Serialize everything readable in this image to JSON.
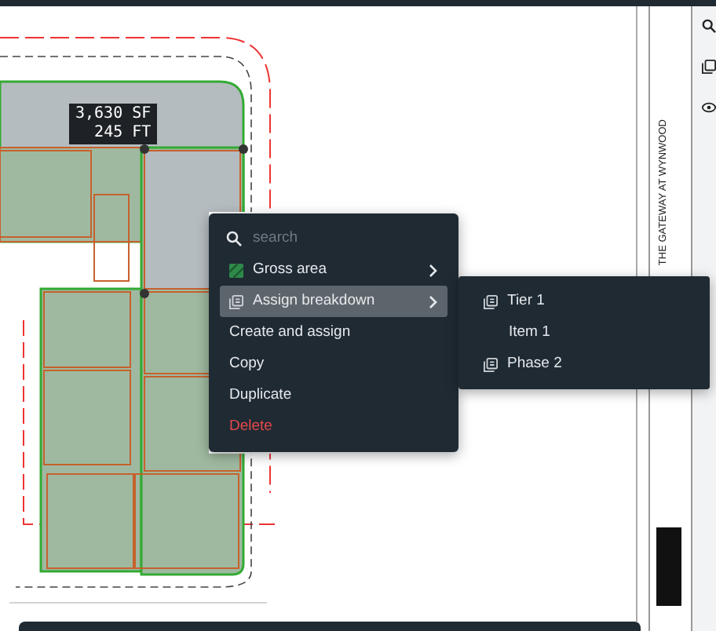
{
  "measurement": {
    "area": "3,630 SF",
    "length": "245 FT"
  },
  "context_menu": {
    "search": {
      "placeholder": "search"
    },
    "items": [
      {
        "label": "Gross area",
        "kind": "swatch",
        "has_submenu": true,
        "selected": false,
        "destructive": false
      },
      {
        "label": "Assign breakdown",
        "kind": "breakdown",
        "has_submenu": true,
        "selected": true,
        "destructive": false
      },
      {
        "label": "Create and assign",
        "kind": "plain",
        "has_submenu": false,
        "selected": false,
        "destructive": false
      },
      {
        "label": "Copy",
        "kind": "plain",
        "has_submenu": false,
        "selected": false,
        "destructive": false
      },
      {
        "label": "Duplicate",
        "kind": "plain",
        "has_submenu": false,
        "selected": false,
        "destructive": false
      },
      {
        "label": "Delete",
        "kind": "plain",
        "has_submenu": false,
        "selected": false,
        "destructive": true
      }
    ]
  },
  "submenu": {
    "items": [
      {
        "label": "Tier 1",
        "kind": "breakdown"
      },
      {
        "label": "Item 1",
        "kind": "plain"
      },
      {
        "label": "Phase 2",
        "kind": "breakdown"
      }
    ]
  },
  "title_block": {
    "title": "THE GATEWAY AT WYNWOOD"
  }
}
